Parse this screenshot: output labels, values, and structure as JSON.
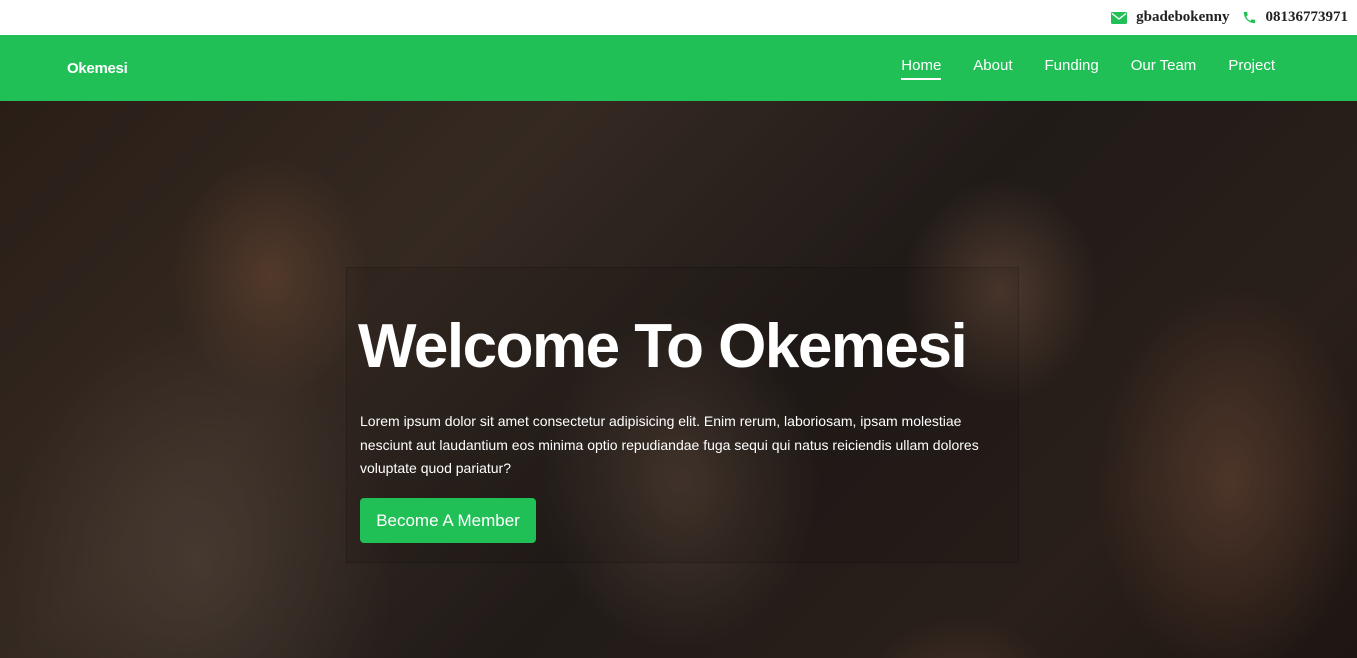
{
  "topbar": {
    "email": "gbadebokenny",
    "phone": "08136773971",
    "email_icon": "envelope-icon",
    "phone_icon": "phone-icon",
    "icon_color": "#21c057"
  },
  "navbar": {
    "brand": "Okemesi",
    "background": "#21c057",
    "links": [
      {
        "label": "Home",
        "active": true
      },
      {
        "label": "About",
        "active": false
      },
      {
        "label": "Funding",
        "active": false
      },
      {
        "label": "Our Team",
        "active": false
      },
      {
        "label": "Project",
        "active": false
      }
    ]
  },
  "hero": {
    "title": "Welcome To Okemesi",
    "text": "Lorem ipsum dolor sit amet consectetur adipisicing elit. Enim rerum, laboriosam, ipsam molestiae nesciunt aut laudantium eos minima optio repudiandae fuga sequi qui natus reiciendis ullam dolores voluptate quod pariatur?",
    "button_label": "Become A Member"
  }
}
